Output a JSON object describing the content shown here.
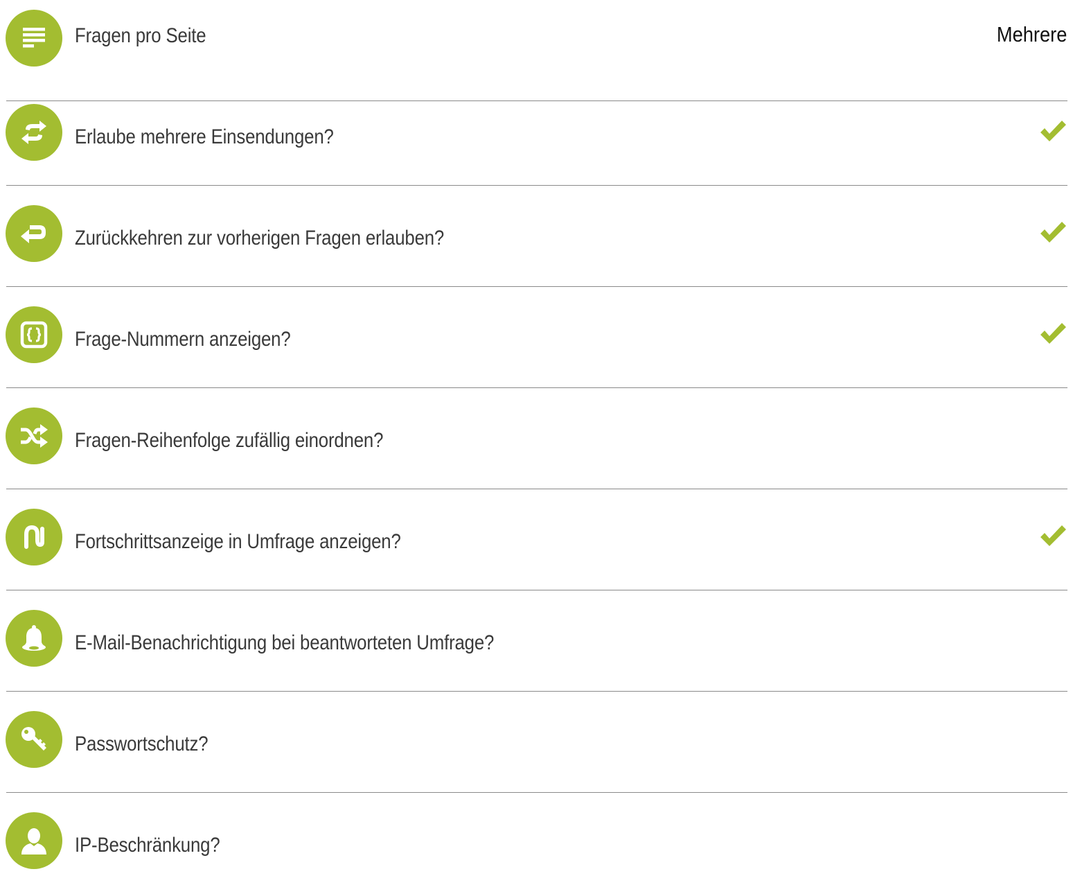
{
  "accent_color": "#a3bd31",
  "settings": [
    {
      "icon": "lines-icon",
      "label": "Fragen pro Seite",
      "value": "Mehrere",
      "checked": false
    },
    {
      "icon": "repeat-icon",
      "label": "Erlaube mehrere Einsendungen?",
      "value": "",
      "checked": true
    },
    {
      "icon": "return-arrow-icon",
      "label": "Zurückkehren zur vorherigen Fragen erlauben?",
      "value": "",
      "checked": true
    },
    {
      "icon": "number-box-icon",
      "label": "Frage-Nummern anzeigen?",
      "value": "",
      "checked": true
    },
    {
      "icon": "shuffle-icon",
      "label": "Fragen-Reihenfolge zufällig einordnen?",
      "value": "",
      "checked": false
    },
    {
      "icon": "progress-path-icon",
      "label": "Fortschrittsanzeige in Umfrage anzeigen?",
      "value": "",
      "checked": true
    },
    {
      "icon": "bell-icon",
      "label": "E-Mail-Benachrichtigung bei beantworteten Umfrage?",
      "value": "",
      "checked": false
    },
    {
      "icon": "key-icon",
      "label": "Passwortschutz?",
      "value": "",
      "checked": false
    },
    {
      "icon": "user-icon",
      "label": "IP-Beschränkung?",
      "value": "",
      "checked": false
    }
  ]
}
